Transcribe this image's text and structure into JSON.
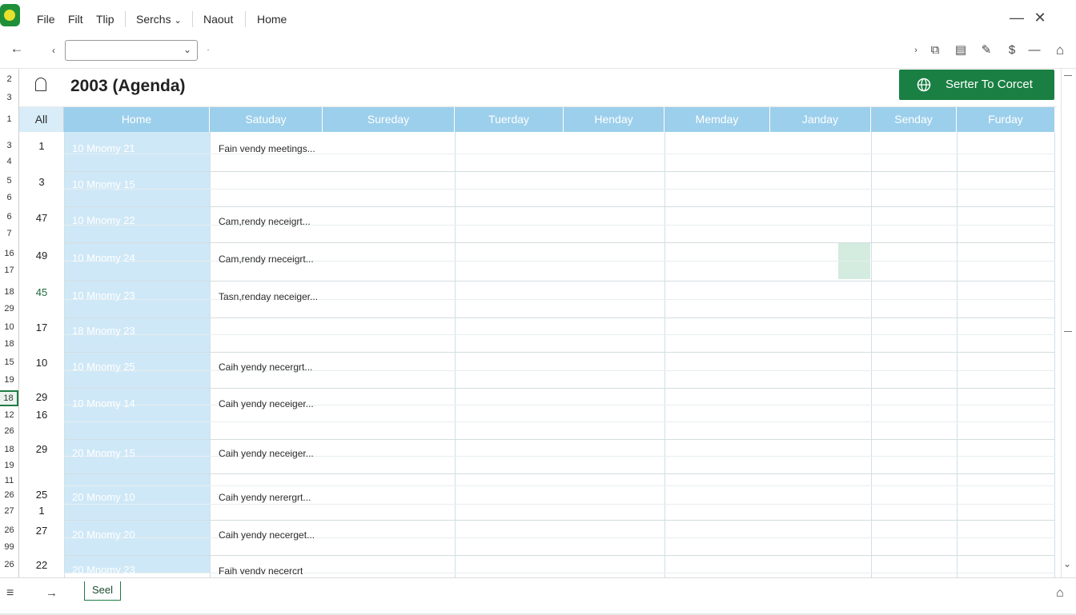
{
  "menu": {
    "items": [
      "File",
      "Filt",
      "Tlip",
      "Serchs",
      "Naout",
      "Home"
    ],
    "serchs_chevron": "⌄"
  },
  "window_controls": {
    "minimize": "—",
    "close": "✕"
  },
  "toolbar": {
    "back_icon": "←",
    "small_chevron_left": "‹",
    "small_chevron_right": "›",
    "address_value": "",
    "address_chevron": "⌄",
    "right_icons": [
      "›",
      "⧉",
      "▤",
      "✎",
      "$",
      "—",
      "⌂"
    ]
  },
  "document": {
    "title": "2003 (Agenda)"
  },
  "action_button": {
    "label": "Serter To Corcet",
    "color": "#1a7f43"
  },
  "columns": [
    "All",
    "Home",
    "Satuday",
    "Sureday",
    "Tuerday",
    "Henday",
    "Memday",
    "Janday",
    "Senday",
    "Furday"
  ],
  "row_headers": [
    "2",
    "3",
    "1",
    "3",
    "4",
    "5",
    "6",
    "6",
    "7",
    "16",
    "17",
    "18",
    "29",
    "10",
    "18",
    "15",
    "19",
    "18",
    "12",
    "26",
    "18",
    "19",
    "11",
    "26",
    "27",
    "26",
    "99",
    "26"
  ],
  "rows": [
    {
      "num": "1",
      "label": "10 Mnomy 21",
      "entry": "Fain vendy meetings..."
    },
    {
      "num": "3",
      "label": "10 Mnomy 15",
      "entry": ""
    },
    {
      "num": "47",
      "label": "10 Mnomy 22",
      "entry": "Cam,rendy neceigrt..."
    },
    {
      "num": "49",
      "label": "10 Mnomy 24",
      "entry": "Cam,rendy rneceigrt..."
    },
    {
      "num": "45",
      "label": "10 Mnomy 23",
      "entry": "Tasn,renday neceiger..."
    },
    {
      "num": "17",
      "label": "18 Mnomy 23",
      "entry": ""
    },
    {
      "num": "10",
      "label": "10 Mnomy 25",
      "entry": "Caih yendy necergrt..."
    },
    {
      "num": "29",
      "label": "10 Mnomy 14",
      "entry": "Caih yendy neceiger...",
      "num2": "16"
    },
    {
      "num": "29",
      "label": "20 Mnomy 15",
      "entry": "Caih yendy neceiger..."
    },
    {
      "num": "25",
      "label": "20 Mnomy 10",
      "entry": "Caih yendy nerergrt...",
      "num2": "1"
    },
    {
      "num": "27",
      "label": "20 Mnomy 20",
      "entry": "Caih yendy necerget..."
    },
    {
      "num": "22",
      "label": "20 Mnomy 23",
      "entry": "Faih yendy necercrt"
    }
  ],
  "sheet_tab": {
    "label": "Seel"
  },
  "tabbar_icons": {
    "menu": "≡",
    "arrow": "→",
    "home": "⌂"
  }
}
